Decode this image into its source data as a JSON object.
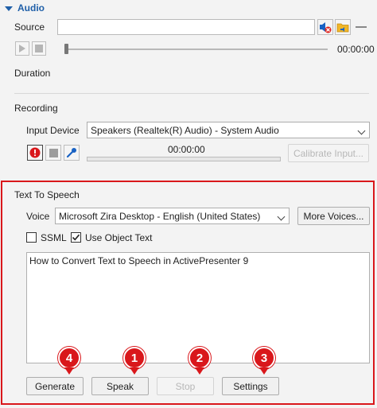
{
  "audio": {
    "section_title": "Audio",
    "source_label": "Source",
    "source_value": "",
    "time": "00:00:00",
    "duration_label": "Duration"
  },
  "recording": {
    "section_label": "Recording",
    "input_device_label": "Input Device",
    "input_device_value": "Speakers (Realtek(R) Audio) - System Audio",
    "time": "00:00:00",
    "calibrate_label": "Calibrate Input..."
  },
  "tts": {
    "section_label": "Text To Speech",
    "voice_label": "Voice",
    "voice_value": "Microsoft Zira Desktop - English (United States)",
    "more_voices_label": "More Voices...",
    "ssml_label": "SSML",
    "ssml_checked": false,
    "use_object_text_label": "Use Object Text",
    "use_object_text_checked": true,
    "text": "How to Convert Text to Speech in ActivePresenter 9",
    "buttons": {
      "generate": "Generate",
      "speak": "Speak",
      "stop": "Stop",
      "settings": "Settings"
    },
    "badges": {
      "generate": "4",
      "speak": "1",
      "stop": "2",
      "settings": "3"
    }
  },
  "colors": {
    "accent": "#1f5fa8",
    "highlight_red": "#d9171b"
  }
}
